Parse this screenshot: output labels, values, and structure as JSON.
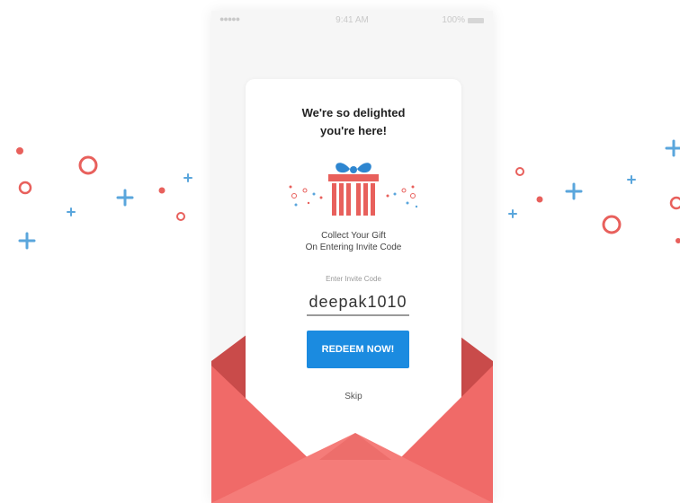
{
  "status_bar": {
    "signal": "●●●●●",
    "time": "9:41 AM",
    "battery": "100%"
  },
  "card": {
    "title_line1": "We're so delighted",
    "title_line2": "you're here!",
    "caption_line1": "Collect Your Gift",
    "caption_line2": "On Entering Invite Code",
    "invite_label": "Enter Invite Code",
    "invite_value": "deepak1010",
    "redeem_label": "REDEEM NOW!",
    "skip_label": "Skip"
  },
  "icons": [
    "gift-icon",
    "signal-icon",
    "battery-icon",
    "circle-icon",
    "plus-icon",
    "dot-icon"
  ],
  "colors": {
    "accent": "#1b8be0",
    "envelope": "#f06a68",
    "envelope_dark": "#c94b4a",
    "confetti_red": "#e8605c",
    "confetti_blue": "#5aa6dc",
    "gift_red": "#e8605c",
    "gift_bow": "#2e86d0"
  }
}
